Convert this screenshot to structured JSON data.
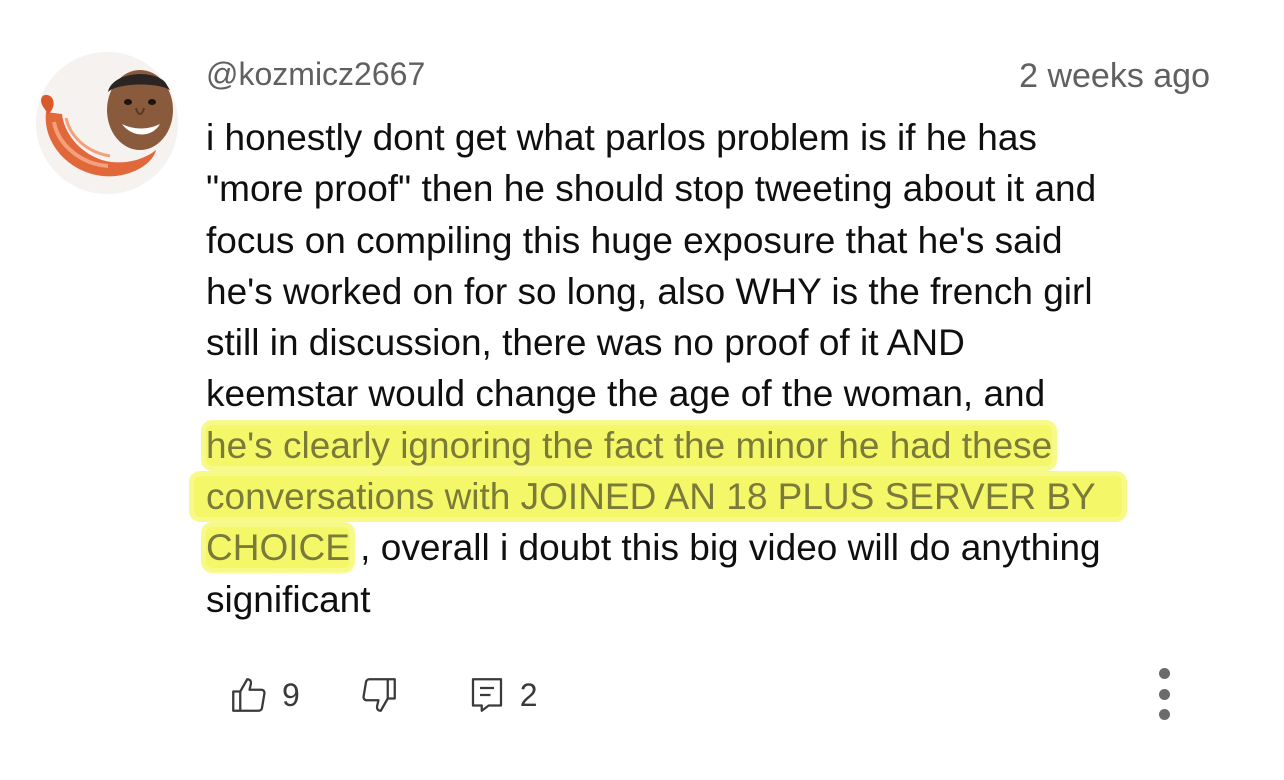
{
  "comment": {
    "author_handle": "@kozmicz2667",
    "timestamp": "2 weeks ago",
    "lines": [
      "i honestly dont get what parlos problem is if he has",
      "\"more proof\" then he should stop tweeting about it and",
      "focus on compiling  this huge exposure that he's said",
      "he's worked on for so long, also WHY is the french girl",
      "still in discussion, there was no proof of it AND",
      "keemstar would change the age of the woman, and"
    ],
    "highlighted": [
      "he's clearly ignoring the fact the minor he had these",
      "conversations with JOINED AN 18 PLUS SERVER BY",
      "CHOICE"
    ],
    "after_highlight": " , overall i doubt this big video will do anything",
    "last_line": "significant"
  },
  "actions": {
    "like_icon": "thumbs-up-icon",
    "like_count": "9",
    "dislike_icon": "thumbs-down-icon",
    "reply_icon": "reply-comment-icon",
    "reply_count": "2",
    "more_icon": "more-vertical-icon"
  },
  "colors": {
    "highlight": "#f0f528",
    "secondary_text": "#606060",
    "primary_text": "#0f0f0f"
  }
}
